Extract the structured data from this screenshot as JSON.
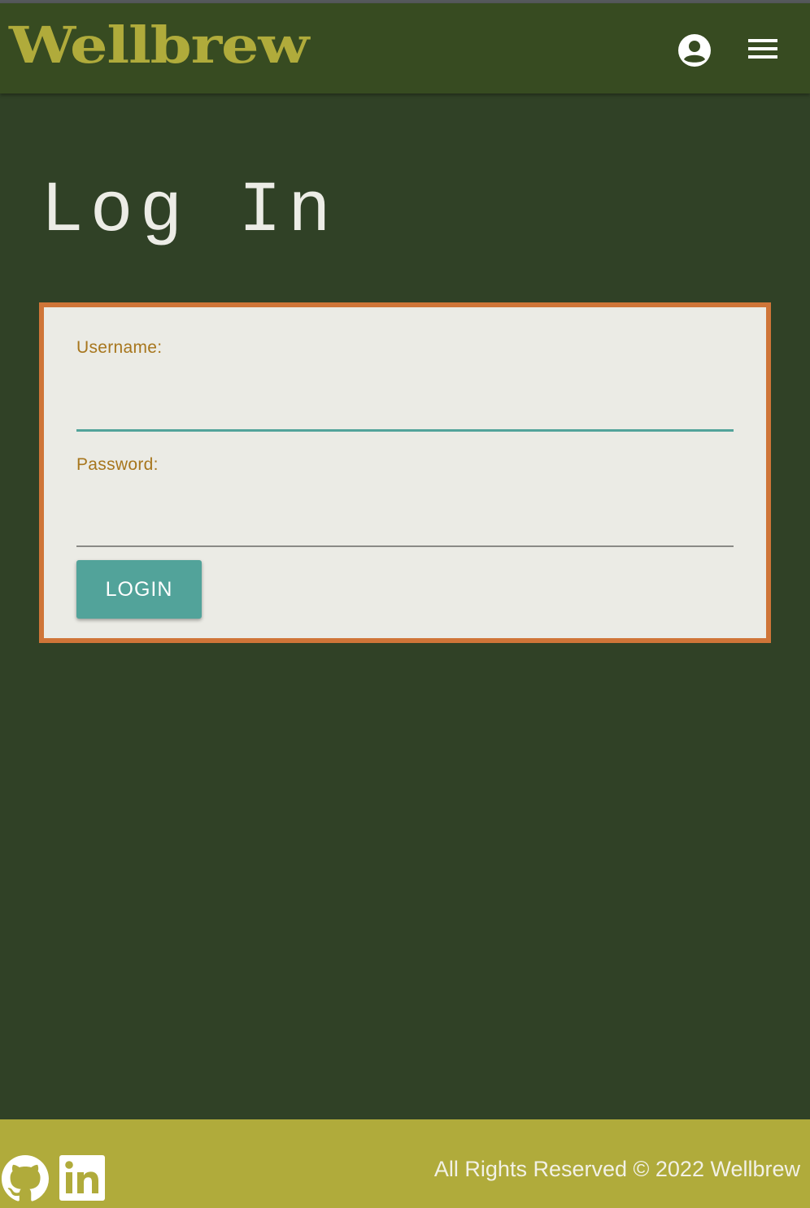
{
  "header": {
    "brand": "Wellbrew",
    "icons": {
      "account": "account-circle-icon",
      "menu": "hamburger-menu-icon"
    }
  },
  "page": {
    "title": "Log In"
  },
  "form": {
    "username_label": "Username:",
    "username_value": "",
    "password_label": "Password:",
    "password_value": "",
    "login_label": "LOGIN"
  },
  "footer": {
    "icons": {
      "github": "github-icon",
      "linkedin": "linkedin-icon"
    },
    "copyright": "All Rights Reserved © 2022 Wellbrew"
  },
  "colors": {
    "background": "#304126",
    "header": "#374b21",
    "brand": "#b0ab3b",
    "card_border": "#cf7538",
    "card_bg": "#ebebe5",
    "label": "#a7761d",
    "accent": "#52a39a",
    "footer": "#b0ab3b"
  }
}
